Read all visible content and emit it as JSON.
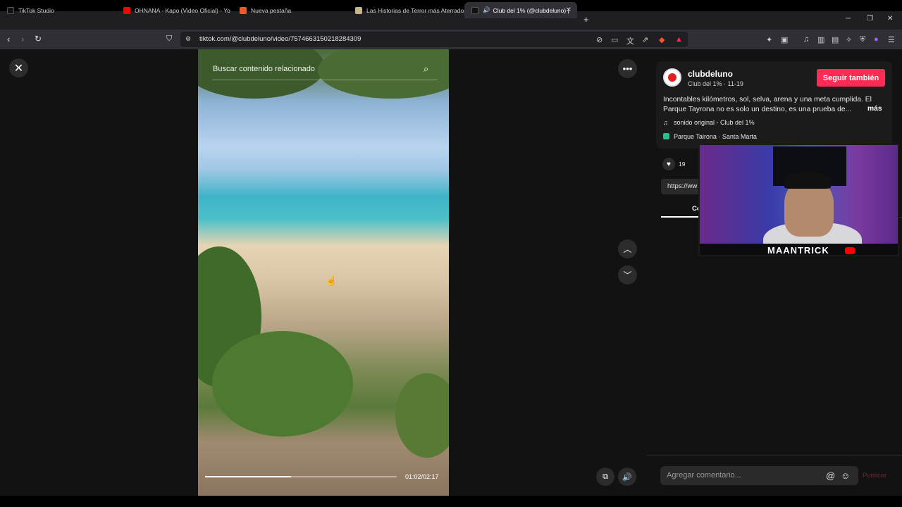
{
  "browser": {
    "tabs": [
      {
        "title": "TikTok Studio",
        "favicon_color": "#111111"
      },
      {
        "title": "OHNANA - Kapo (Video Oficial) - Yo",
        "favicon_color": "#ff0000"
      },
      {
        "title": "Nueva pestaña",
        "favicon_color": "#fb542b"
      },
      {
        "title": "Las Historias de Terror más Aterrador",
        "favicon_color": "#c8b48a"
      },
      {
        "title": "Club del 1% (@clubdeluno) |",
        "favicon_color": "#111111"
      }
    ],
    "new_tab_icon": "+",
    "url": "tiktok.com/@clubdeluno/video/7574663150218284309"
  },
  "video": {
    "search_placeholder": "Buscar contenido relacionado",
    "time": "01:02/02:17",
    "progress": 0.45
  },
  "post": {
    "username": "clubdeluno",
    "subline": "Club del 1% · 11-19",
    "follow_label": "Seguir también",
    "description": "Incontables kilómetros, sol, selva, arena y una meta cumplida. El Parque Tayrona no es solo un destino, es una prueba de...",
    "more_label": "más",
    "sound": "sonido original - Club del 1%",
    "location": "Parque Tairona · Santa Marta",
    "likes": "19",
    "link_partial": "https://ww",
    "tab_partial": "Co"
  },
  "webcam": {
    "label": "MAANTRICK"
  },
  "comment": {
    "placeholder": "Agregar comentario...",
    "at_symbol": "@",
    "publish_label": "Publicar"
  },
  "colors": {
    "accent": "#fe2c55",
    "panel": "#121212"
  }
}
